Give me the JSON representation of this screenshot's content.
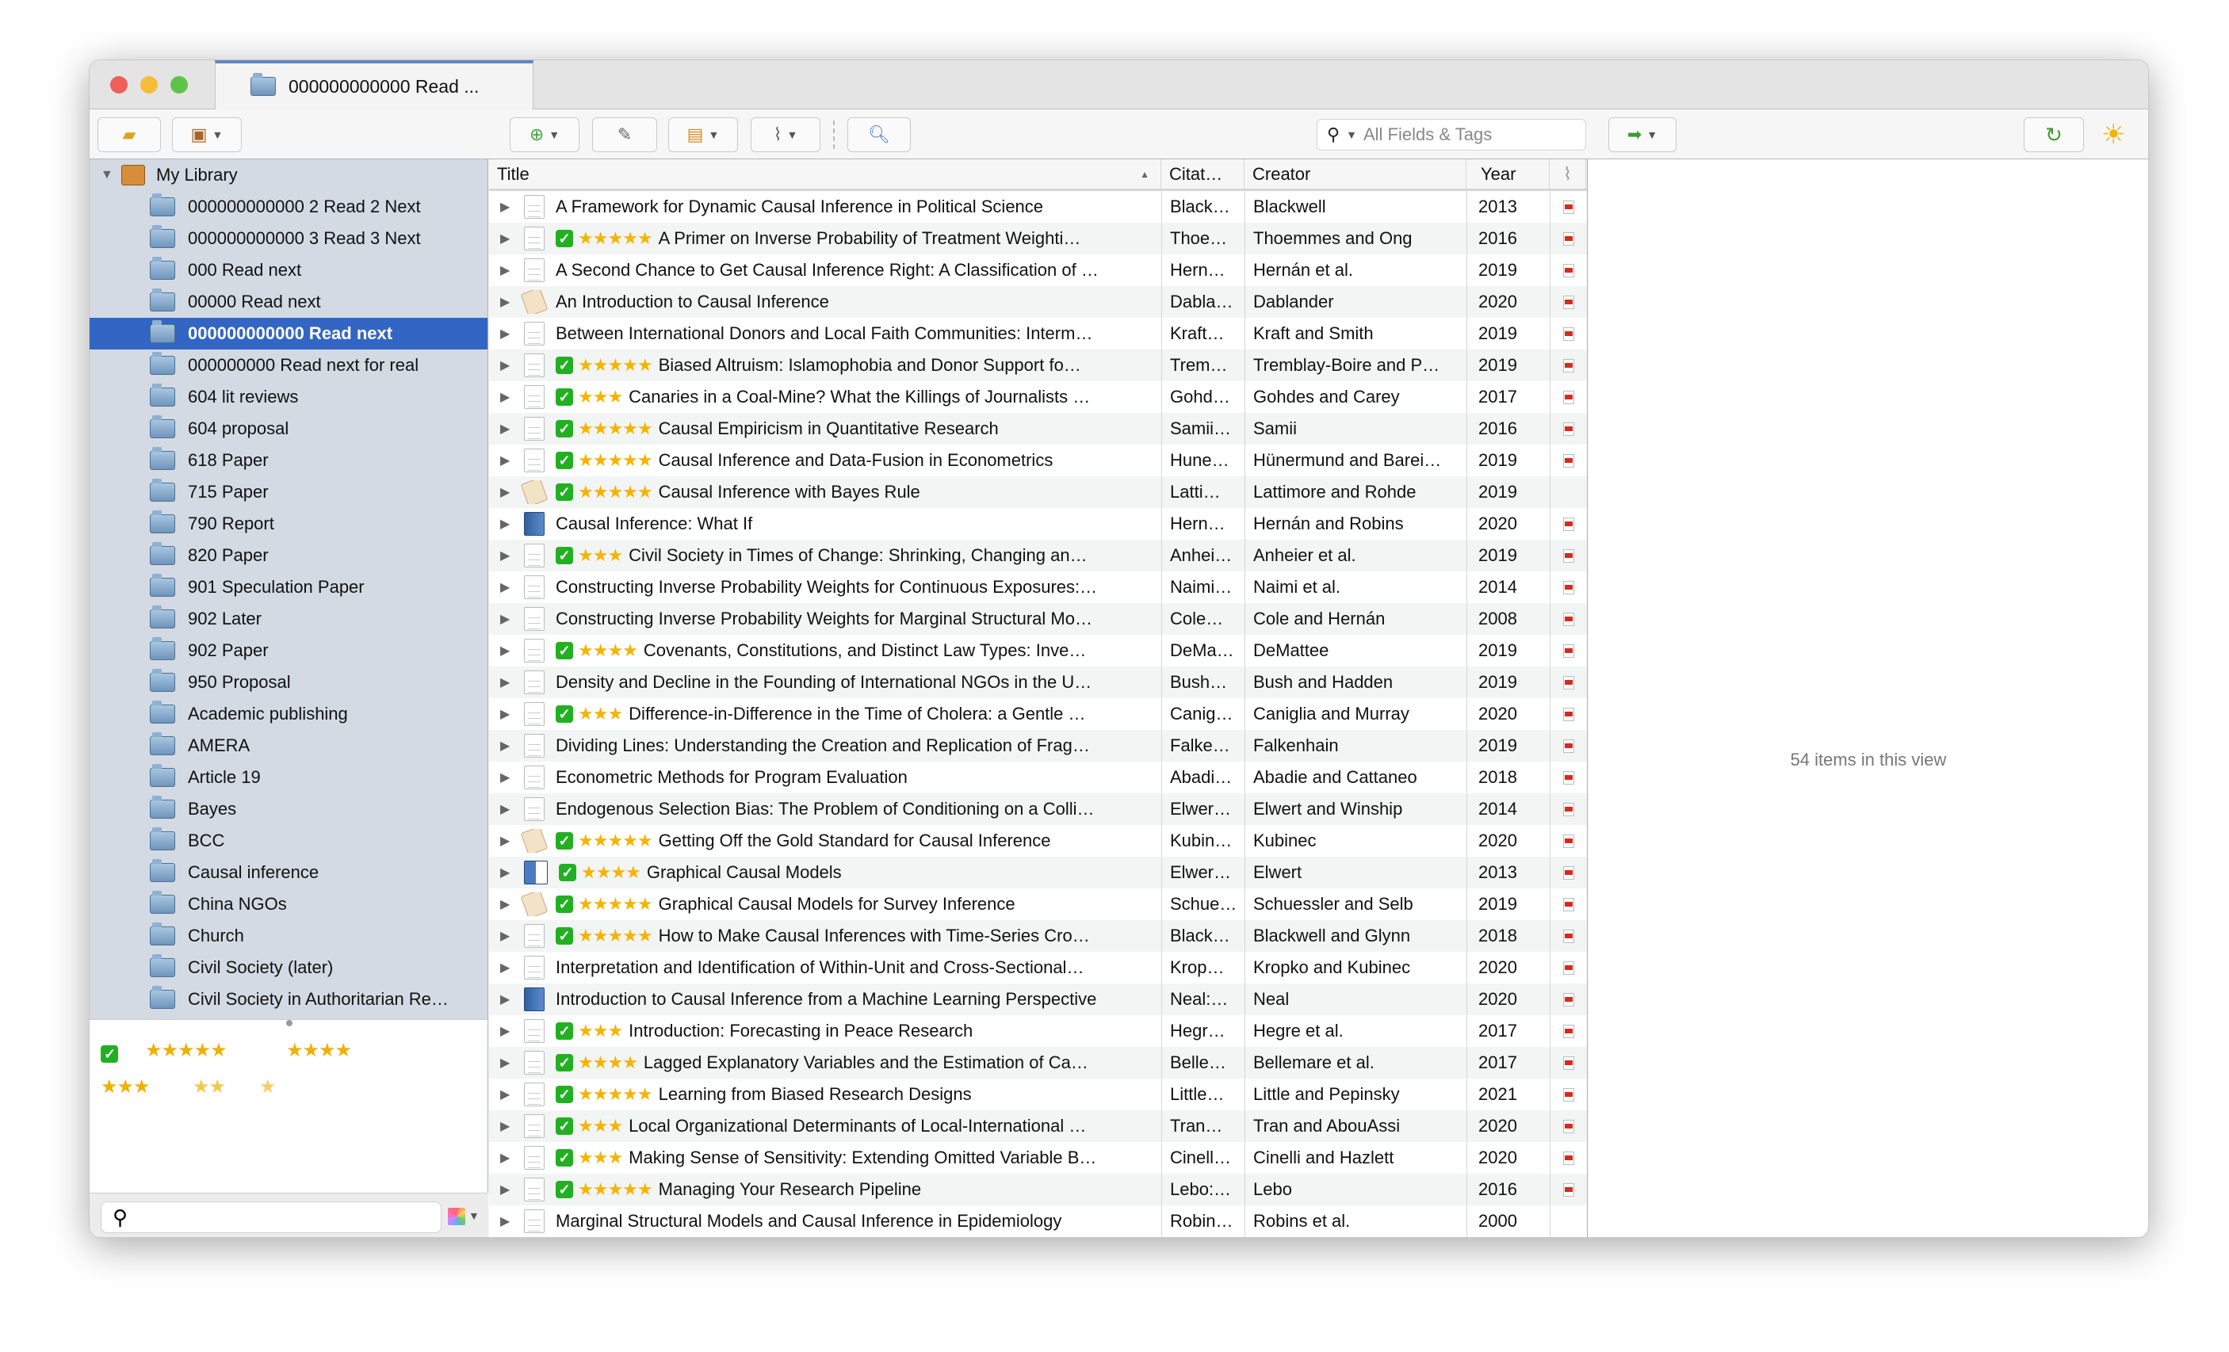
{
  "window": {
    "tab_title": "000000000000 Read ..."
  },
  "toolbar": {
    "search_placeholder": "All Fields & Tags"
  },
  "colors": {
    "accent": "#3366c4",
    "sidebar_bg": "#d3dae3",
    "star": "#f4b400",
    "check": "#22b022"
  },
  "sidebar": {
    "library": "My Library",
    "selected_index": 4,
    "collections": [
      "000000000000 2 Read 2 Next",
      "000000000000 3 Read 3 Next",
      "000 Read next",
      "00000 Read next",
      "000000000000 Read next",
      "000000000 Read next for real",
      "604 lit reviews",
      "604 proposal",
      "618 Paper",
      "715 Paper",
      "790 Report",
      "820 Paper",
      "901 Speculation Paper",
      "902 Later",
      "902 Paper",
      "950 Proposal",
      "Academic publishing",
      "AMERA",
      "Article 19",
      "Bayes",
      "BCC",
      "Causal inference",
      "China NGOs",
      "Church",
      "Civil Society (later)",
      "Civil Society in Authoritarian Re…"
    ]
  },
  "tags": {
    "check": "✓",
    "r5": "★★★★★",
    "r4": "★★★★",
    "r3": "★★★",
    "r2": "★★",
    "r1": "★"
  },
  "columns": {
    "title": "Title",
    "citation": "Citat…",
    "creator": "Creator",
    "year": "Year"
  },
  "items": [
    {
      "icon": "doc",
      "check": false,
      "stars": 0,
      "title": "A Framework for Dynamic Causal Inference in Political Science",
      "citation": "Black…",
      "creator": "Blackwell",
      "year": "2013",
      "pdf": true
    },
    {
      "icon": "doc",
      "check": true,
      "stars": 5,
      "title": "A Primer on Inverse Probability of Treatment Weighti…",
      "citation": "Thoe…",
      "creator": "Thoemmes and Ong",
      "year": "2016",
      "pdf": true
    },
    {
      "icon": "doc",
      "check": false,
      "stars": 0,
      "title": "A Second Chance to Get Causal Inference Right: A Classification of …",
      "citation": "Hern…",
      "creator": "Hernán et al.",
      "year": "2019",
      "pdf": true
    },
    {
      "icon": "script",
      "check": false,
      "stars": 0,
      "title": "An Introduction to Causal Inference",
      "citation": "Dabla…",
      "creator": "Dablander",
      "year": "2020",
      "pdf": true
    },
    {
      "icon": "doc",
      "check": false,
      "stars": 0,
      "title": "Between International Donors and Local Faith Communities: Interm…",
      "citation": "Kraft…",
      "creator": "Kraft and Smith",
      "year": "2019",
      "pdf": true
    },
    {
      "icon": "doc",
      "check": true,
      "stars": 5,
      "title": "Biased Altruism: Islamophobia and Donor Support fo…",
      "citation": "Trem…",
      "creator": "Tremblay-Boire and P…",
      "year": "2019",
      "pdf": true
    },
    {
      "icon": "doc",
      "check": true,
      "stars": 3,
      "title": "Canaries in a Coal-Mine? What the Killings of Journalists …",
      "citation": "Gohd…",
      "creator": "Gohdes and Carey",
      "year": "2017",
      "pdf": true
    },
    {
      "icon": "doc",
      "check": true,
      "stars": 5,
      "title": "Causal Empiricism in Quantitative Research",
      "citation": "Samii…",
      "creator": "Samii",
      "year": "2016",
      "pdf": true
    },
    {
      "icon": "doc",
      "check": true,
      "stars": 5,
      "title": "Causal Inference and Data-Fusion in Econometrics",
      "citation": "Hune…",
      "creator": "Hünermund and Barei…",
      "year": "2019",
      "pdf": true
    },
    {
      "icon": "script",
      "check": true,
      "stars": 5,
      "title": "Causal Inference with Bayes Rule",
      "citation": "Latti…",
      "creator": "Lattimore and Rohde",
      "year": "2019",
      "pdf": false
    },
    {
      "icon": "book",
      "check": false,
      "stars": 0,
      "title": "Causal Inference: What If",
      "citation": "Hern…",
      "creator": "Hernán and Robins",
      "year": "2020",
      "pdf": true
    },
    {
      "icon": "doc",
      "check": true,
      "stars": 3,
      "title": "Civil Society in Times of Change: Shrinking, Changing an…",
      "citation": "Anhei…",
      "creator": "Anheier et al.",
      "year": "2019",
      "pdf": true
    },
    {
      "icon": "doc",
      "check": false,
      "stars": 0,
      "title": "Constructing Inverse Probability Weights for Continuous Exposures:…",
      "citation": "Naimi…",
      "creator": "Naimi et al.",
      "year": "2014",
      "pdf": true
    },
    {
      "icon": "doc",
      "check": false,
      "stars": 0,
      "title": "Constructing Inverse Probability Weights for Marginal Structural Mo…",
      "citation": "Cole…",
      "creator": "Cole and Hernán",
      "year": "2008",
      "pdf": true
    },
    {
      "icon": "doc",
      "check": true,
      "stars": 4,
      "title": "Covenants, Constitutions, and Distinct Law Types: Inve…",
      "citation": "DeMa…",
      "creator": "DeMattee",
      "year": "2019",
      "pdf": true
    },
    {
      "icon": "doc",
      "check": false,
      "stars": 0,
      "title": "Density and Decline in the Founding of International NGOs in the U…",
      "citation": "Bush…",
      "creator": "Bush and Hadden",
      "year": "2019",
      "pdf": true
    },
    {
      "icon": "doc",
      "check": true,
      "stars": 3,
      "title": "Difference-in-Difference in the Time of Cholera: a Gentle …",
      "citation": "Canig…",
      "creator": "Caniglia and Murray",
      "year": "2020",
      "pdf": true
    },
    {
      "icon": "doc",
      "check": false,
      "stars": 0,
      "title": "Dividing Lines: Understanding the Creation and Replication of Frag…",
      "citation": "Falke…",
      "creator": "Falkenhain",
      "year": "2019",
      "pdf": true
    },
    {
      "icon": "doc",
      "check": false,
      "stars": 0,
      "title": "Econometric Methods for Program Evaluation",
      "citation": "Abadi…",
      "creator": "Abadie and Cattaneo",
      "year": "2018",
      "pdf": true
    },
    {
      "icon": "doc",
      "check": false,
      "stars": 0,
      "title": "Endogenous Selection Bias: The Problem of Conditioning on a Colli…",
      "citation": "Elwer…",
      "creator": "Elwert and Winship",
      "year": "2014",
      "pdf": true
    },
    {
      "icon": "script",
      "check": true,
      "stars": 5,
      "title": "Getting Off the Gold Standard for Causal Inference",
      "citation": "Kubin…",
      "creator": "Kubinec",
      "year": "2020",
      "pdf": true
    },
    {
      "icon": "booksection",
      "check": true,
      "stars": 4,
      "title": "Graphical Causal Models",
      "citation": "Elwer…",
      "creator": "Elwert",
      "year": "2013",
      "pdf": true
    },
    {
      "icon": "script",
      "check": true,
      "stars": 5,
      "title": "Graphical Causal Models for Survey Inference",
      "citation": "Schue…",
      "creator": "Schuessler and Selb",
      "year": "2019",
      "pdf": true
    },
    {
      "icon": "doc",
      "check": true,
      "stars": 5,
      "title": "How to Make Causal Inferences with Time-Series Cro…",
      "citation": "Black…",
      "creator": "Blackwell and Glynn",
      "year": "2018",
      "pdf": true
    },
    {
      "icon": "doc",
      "check": false,
      "stars": 0,
      "title": "Interpretation and Identification of Within-Unit and Cross-Sectional…",
      "citation": "Krop…",
      "creator": "Kropko and Kubinec",
      "year": "2020",
      "pdf": true
    },
    {
      "icon": "book",
      "check": false,
      "stars": 0,
      "title": "Introduction to Causal Inference from a Machine Learning Perspective",
      "citation": "Neal:…",
      "creator": "Neal",
      "year": "2020",
      "pdf": true
    },
    {
      "icon": "doc",
      "check": true,
      "stars": 3,
      "title": "Introduction: Forecasting in Peace Research",
      "citation": "Hegr…",
      "creator": "Hegre et al.",
      "year": "2017",
      "pdf": true
    },
    {
      "icon": "doc",
      "check": true,
      "stars": 4,
      "title": "Lagged Explanatory Variables and the Estimation of Ca…",
      "citation": "Belle…",
      "creator": "Bellemare et al.",
      "year": "2017",
      "pdf": true
    },
    {
      "icon": "doc",
      "check": true,
      "stars": 5,
      "title": "Learning from Biased Research Designs",
      "citation": "Little…",
      "creator": "Little and Pepinsky",
      "year": "2021",
      "pdf": true
    },
    {
      "icon": "doc",
      "check": true,
      "stars": 3,
      "title": "Local Organizational Determinants of Local-International …",
      "citation": "Tran…",
      "creator": "Tran and AbouAssi",
      "year": "2020",
      "pdf": true
    },
    {
      "icon": "doc",
      "check": true,
      "stars": 3,
      "title": "Making Sense of Sensitivity: Extending Omitted Variable B…",
      "citation": "Cinell…",
      "creator": "Cinelli and Hazlett",
      "year": "2020",
      "pdf": true
    },
    {
      "icon": "doc",
      "check": true,
      "stars": 5,
      "title": "Managing Your Research Pipeline",
      "citation": "Lebo:…",
      "creator": "Lebo",
      "year": "2016",
      "pdf": true
    },
    {
      "icon": "doc",
      "check": false,
      "stars": 0,
      "title": "Marginal Structural Models and Causal Inference in Epidemiology",
      "citation": "Robin…",
      "creator": "Robins et al.",
      "year": "2000",
      "pdf": false
    }
  ],
  "status": {
    "count_text": "54 items in this view"
  }
}
